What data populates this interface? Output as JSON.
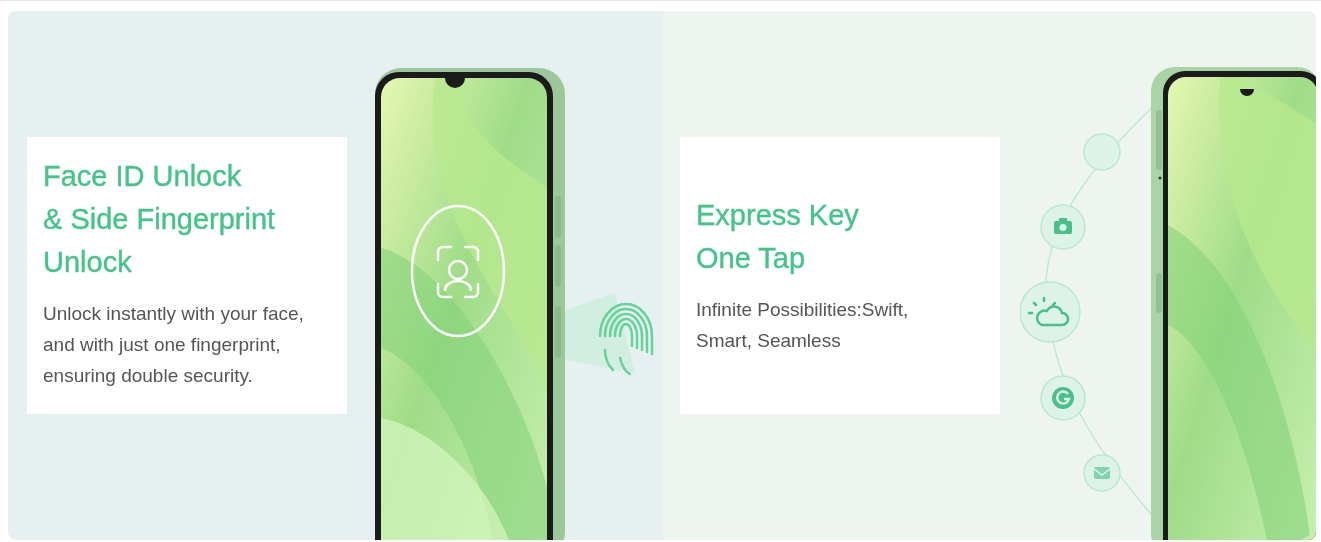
{
  "panels": [
    {
      "kind": "face-fingerprint",
      "heading_lines": [
        "Face ID Unlock",
        "& Side Fingerprint",
        "Unlock"
      ],
      "body_lines": [
        "Unlock instantly with your face,",
        "and with just one fingerprint,",
        "ensuring double security."
      ]
    },
    {
      "kind": "express-key",
      "heading_lines": [
        "Express Key",
        "One Tap"
      ],
      "body_lines": [
        "Infinite Possibilities:Swift,",
        "Smart, Seamless"
      ]
    }
  ]
}
